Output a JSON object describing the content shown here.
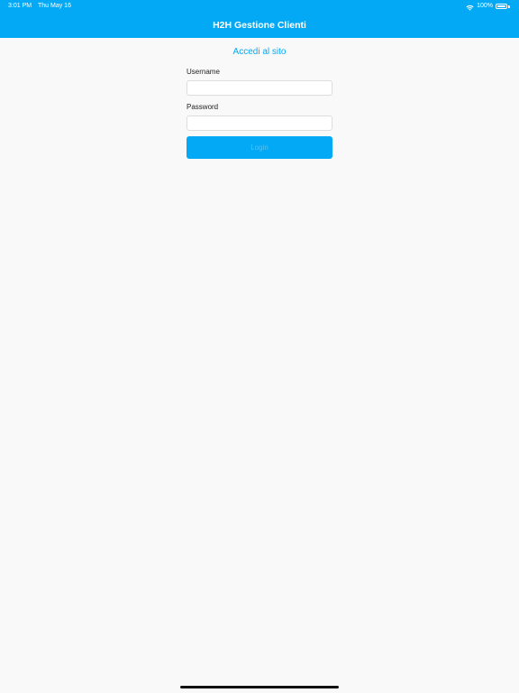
{
  "status_bar": {
    "time": "3:01 PM",
    "date": "Thu May 16",
    "battery_percent": "100%",
    "battery_level": 1.0,
    "icons": [
      "wifi-icon",
      "battery-icon"
    ]
  },
  "header": {
    "title": "H2H Gestione Clienti"
  },
  "login": {
    "heading": "Accedi al sito",
    "username_label": "Username",
    "username_value": "",
    "password_label": "Password",
    "password_value": "",
    "button_label": "Login"
  },
  "colors": {
    "accent": "#03a9f4",
    "background": "#f9f9f9"
  }
}
